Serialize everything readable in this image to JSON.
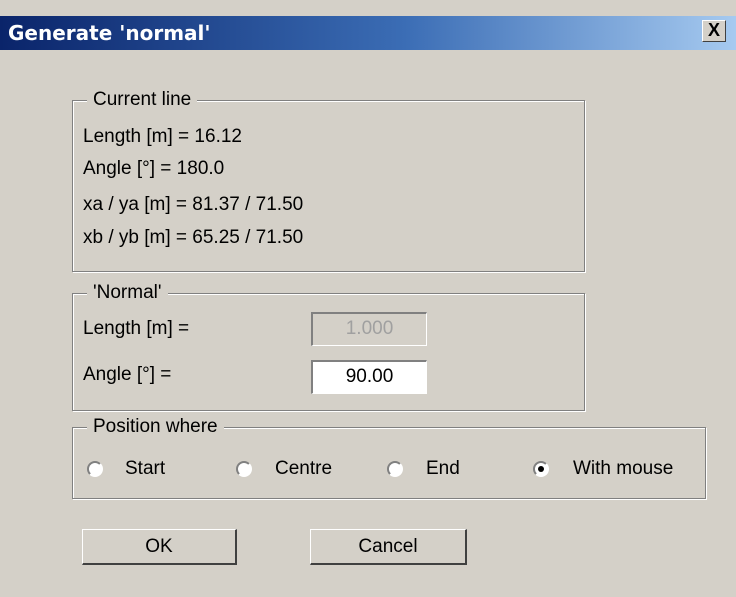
{
  "window": {
    "title": "Generate 'normal'",
    "close_label": "X"
  },
  "current_line": {
    "legend": "Current line",
    "length": "Length [m] = 16.12",
    "angle": "Angle [°] = 180.0",
    "start": "xa / ya [m] = 81.37 / 71.50",
    "end": "xb / yb [m] = 65.25 / 71.50"
  },
  "normal": {
    "legend": "'Normal'",
    "length_label": "Length [m] =",
    "length_value": "1.000",
    "angle_label": "Angle [°] =",
    "angle_value": "90.00"
  },
  "position": {
    "legend": "Position where",
    "options": [
      "Start",
      "Centre",
      "End",
      "With mouse"
    ],
    "selected": "With mouse"
  },
  "buttons": {
    "ok": "OK",
    "cancel": "Cancel"
  }
}
